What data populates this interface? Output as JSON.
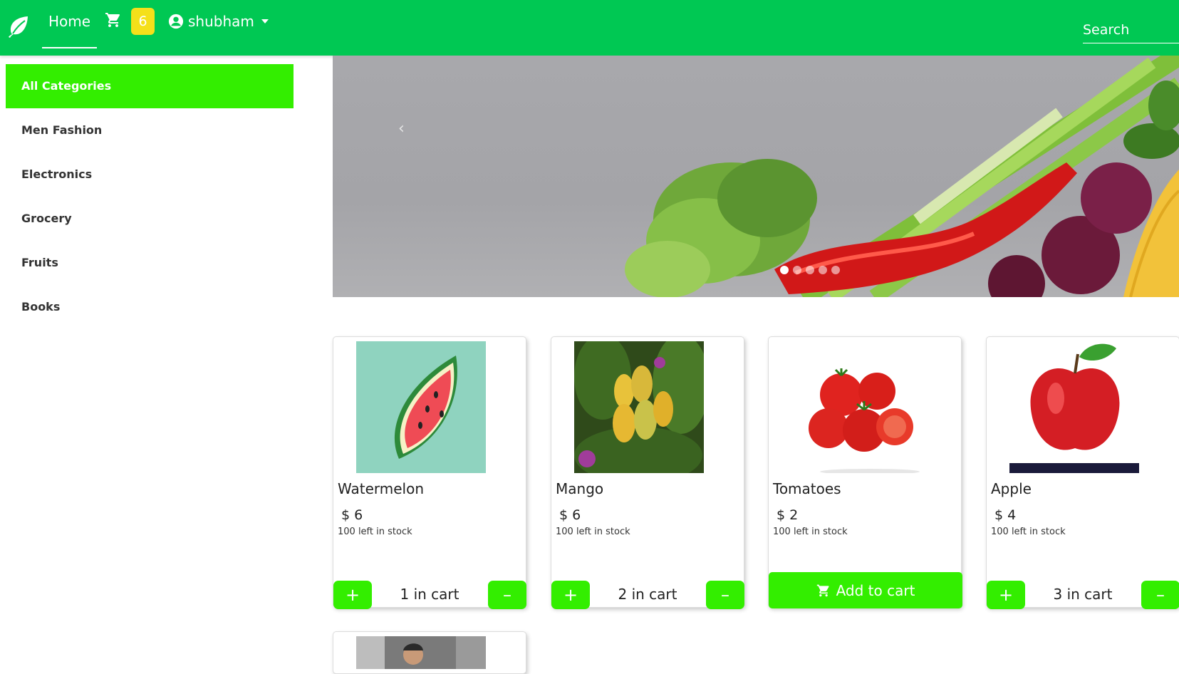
{
  "navbar": {
    "home_label": "Home",
    "cart_count": "6",
    "user_name": "shubham",
    "search_placeholder": "Search",
    "brand_color": "#00c853",
    "badge_color": "#f5e01a"
  },
  "sidebar": {
    "accent_color": "#33ee00",
    "items": [
      {
        "label": "All Categories",
        "active": true
      },
      {
        "label": "Men Fashion"
      },
      {
        "label": "Electronics"
      },
      {
        "label": "Grocery"
      },
      {
        "label": "Fruits"
      },
      {
        "label": "Books"
      }
    ]
  },
  "carousel": {
    "prev_symbol": "‹",
    "slide_count": 5,
    "active_slide": 1,
    "image": "vegetables-banner"
  },
  "products": [
    {
      "name": "Watermelon",
      "currency": "$",
      "price": "6",
      "stock": "100 left in stock",
      "cart_text": "1 in cart",
      "image": "watermelon-image"
    },
    {
      "name": "Mango",
      "currency": "$",
      "price": "6",
      "stock": "100 left in stock",
      "cart_text": "2 in cart",
      "image": "mango-image"
    },
    {
      "name": "Tomatoes",
      "currency": "$",
      "price": "2",
      "stock": "100 left in stock",
      "add_label": "Add to cart",
      "image": "tomatoes-image"
    },
    {
      "name": "Apple",
      "currency": "$",
      "price": "4",
      "stock": "100 left in stock",
      "cart_text": "3 in cart",
      "image": "apple-image"
    }
  ],
  "buttons": {
    "plus_symbol": "+",
    "minus_symbol": "–"
  }
}
